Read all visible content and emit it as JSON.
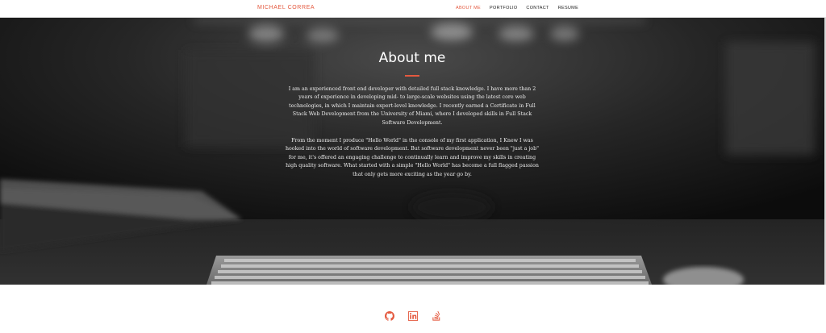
{
  "navbar": {
    "brand": "MICHAEL CORREA",
    "links": [
      {
        "label": "ABOUT ME",
        "active": true
      },
      {
        "label": "PORTFOLIO",
        "active": false
      },
      {
        "label": "CONTACT",
        "active": false
      },
      {
        "label": "RESUME",
        "active": false
      }
    ]
  },
  "about": {
    "title": "About me",
    "paragraphs": [
      "I am an experienced front end developer with detailed full stack knowledge. I have more than 2 years of experience in developing mid- to large-scale websites using the latest core web technologies, in which I maintain expert-level knowledge. I recently earned a Certificate in Full Stack Web Development from the University of Miami, where I developed skills in Full Stack Software Development.",
      "From the moment I produce \"Hello World\" in the console of my first application, I Knew I was hooked into the world of software development. But software development never been \"just a job\" for me, it's offered an engaging challenge to continually learn and improve my skills in creating high quality software. What started with a simple \"Hello World\" has become a full flagged passion that only gets more exciting as the year go by."
    ]
  },
  "footer": {
    "icons": [
      "github-icon",
      "linkedin-icon",
      "stackoverflow-icon"
    ]
  },
  "colors": {
    "accent": "#e4593f",
    "nav_text": "#222222",
    "hero_text": "#ececec"
  }
}
